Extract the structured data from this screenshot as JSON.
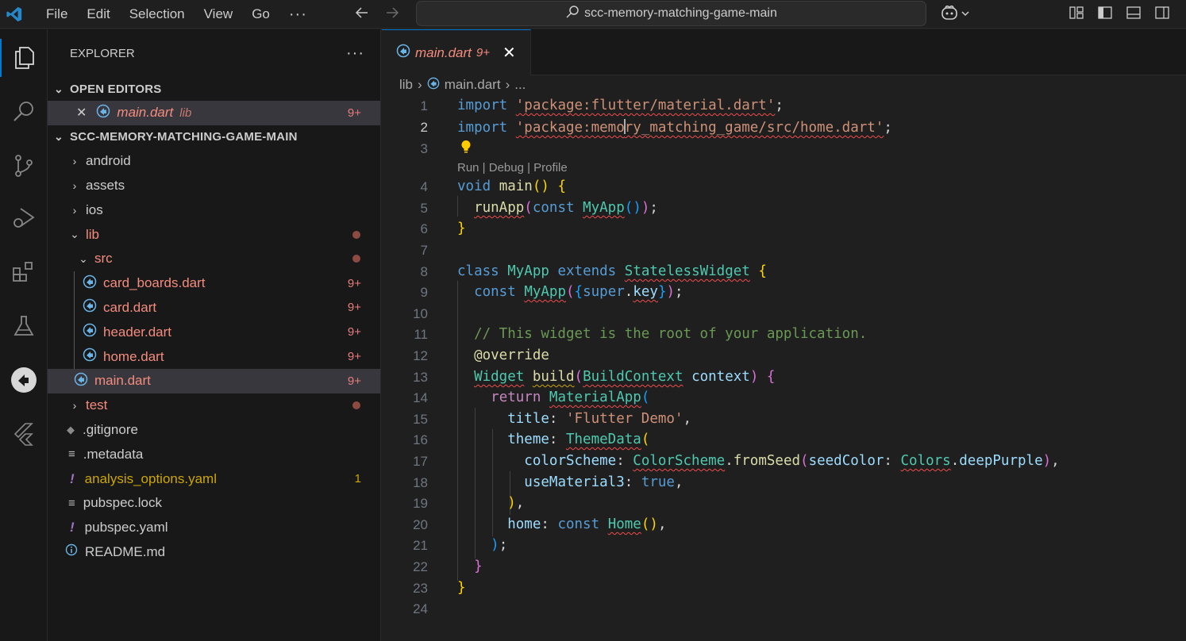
{
  "menu": [
    "File",
    "Edit",
    "Selection",
    "View",
    "Go"
  ],
  "menu_more": "···",
  "search_text": "scc-memory-matching-game-main",
  "sidebar": {
    "title": "EXPLORER",
    "more": "···",
    "open_editors_label": "OPEN EDITORS",
    "open_editor": {
      "name": "main.dart",
      "desc": "lib",
      "badge": "9+"
    },
    "project_label": "SCC-MEMORY-MATCHING-GAME-MAIN",
    "tree": [
      {
        "name": "android",
        "kind": "folder"
      },
      {
        "name": "assets",
        "kind": "folder"
      },
      {
        "name": "ios",
        "kind": "folder"
      },
      {
        "name": "lib",
        "kind": "folder-open"
      },
      {
        "name": "src",
        "kind": "folder-open"
      },
      {
        "name": "card_boards.dart",
        "badge": "9+"
      },
      {
        "name": "card.dart",
        "badge": "9+"
      },
      {
        "name": "header.dart",
        "badge": "9+"
      },
      {
        "name": "home.dart",
        "badge": "9+"
      },
      {
        "name": "main.dart",
        "badge": "9+"
      },
      {
        "name": "test",
        "kind": "folder"
      },
      {
        "name": ".gitignore"
      },
      {
        "name": ".metadata"
      },
      {
        "name": "analysis_options.yaml",
        "badge": "1"
      },
      {
        "name": "pubspec.lock"
      },
      {
        "name": "pubspec.yaml"
      },
      {
        "name": "README.md"
      }
    ]
  },
  "editor": {
    "tab": {
      "name": "main.dart",
      "count": "9+",
      "close": "✕"
    },
    "breadcrumb": [
      "lib",
      "main.dart",
      "..."
    ],
    "codelens": "Run | Debug | Profile",
    "line_numbers": [
      "1",
      "2",
      "3",
      "4",
      "5",
      "6",
      "7",
      "8",
      "9",
      "10",
      "11",
      "12",
      "13",
      "14",
      "15",
      "16",
      "17",
      "18",
      "19",
      "20",
      "21",
      "22",
      "23",
      "24"
    ],
    "code": [
      "import 'package:flutter/material.dart';",
      "import 'package:memory_matching_game/src/home.dart';",
      "",
      "void main() {",
      "  runApp(const MyApp());",
      "}",
      "",
      "class MyApp extends StatelessWidget {",
      "  const MyApp({super.key});",
      "",
      "  // This widget is the root of your application.",
      "  @override",
      "  Widget build(BuildContext context) {",
      "    return MaterialApp(",
      "      title: 'Flutter Demo',",
      "      theme: ThemeData(",
      "        colorScheme: ColorScheme.fromSeed(seedColor: Colors.deepPurple),",
      "        useMaterial3: true,",
      "      ),",
      "      home: const Home(),",
      "    );",
      "  }",
      "}",
      ""
    ]
  }
}
